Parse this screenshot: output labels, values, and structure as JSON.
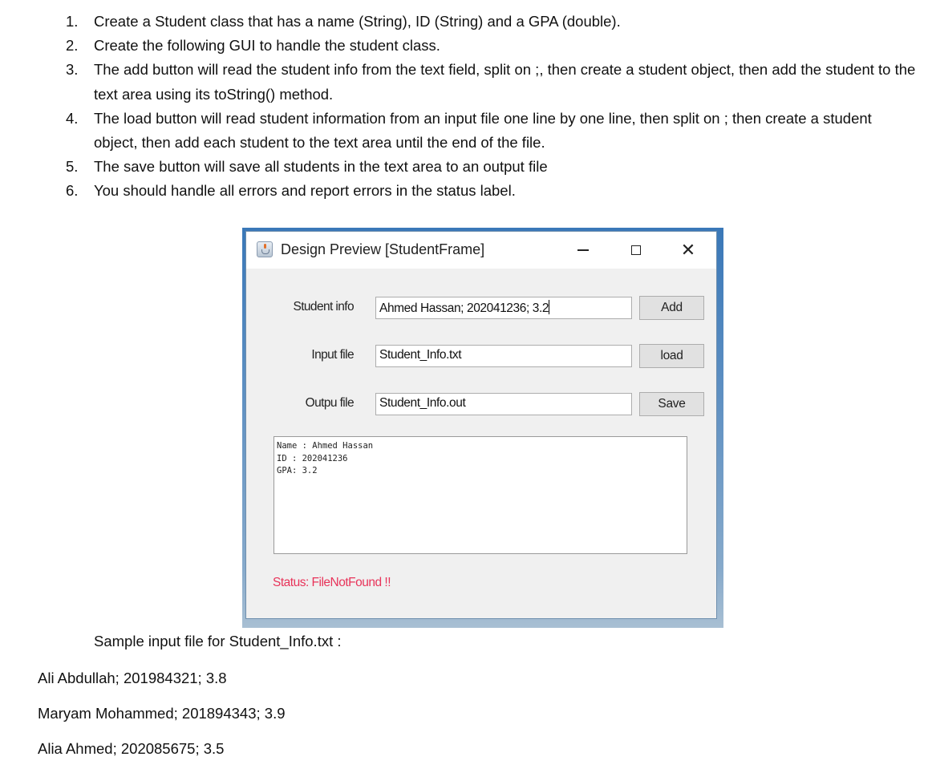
{
  "instructions": [
    {
      "num": "1.",
      "text": "Create a Student class that has a name (String), ID (String) and a GPA (double)."
    },
    {
      "num": "2.",
      "text": "Create the following GUI to handle the student class."
    },
    {
      "num": "3.",
      "text": "The add button will read the student info from the text field, split on ;, then create a student object, then add the student to the text area using its toString() method."
    },
    {
      "num": "4.",
      "text": "The load button will read student information from an input file one line by one line, then split on ; then create a student object, then add each student to the text area until the end of the file."
    },
    {
      "num": "5.",
      "text": "The save button will save all students in the text area to an output file"
    },
    {
      "num": "6.",
      "text": "You should handle all errors and report errors in the status label."
    }
  ],
  "window": {
    "title": "Design Preview [StudentFrame]",
    "controls": {
      "minimize": "minimize-icon",
      "maximize": "maximize-icon",
      "close": "✕"
    },
    "fields": {
      "student_info": {
        "label": "Student info",
        "value": "Ahmed Hassan; 202041236; 3.2",
        "button": "Add"
      },
      "input_file": {
        "label": "Input file",
        "value": "Student_Info.txt",
        "button": "load"
      },
      "output_file": {
        "label": "Outpu file",
        "value": "Student_Info.out",
        "button": "Save"
      }
    },
    "text_area_lines": [
      "Name : Ahmed Hassan",
      "ID : 202041236",
      "GPA: 3.2"
    ],
    "status": "Status: FileNotFound !!",
    "status_color": "#e8345a"
  },
  "sample": {
    "heading": "Sample input file for Student_Info.txt :",
    "lines": [
      "Ali Abdullah; 201984321; 3.8",
      "Maryam Mohammed; 201894343; 3.9",
      "Alia Ahmed; 202085675; 3.5"
    ]
  }
}
